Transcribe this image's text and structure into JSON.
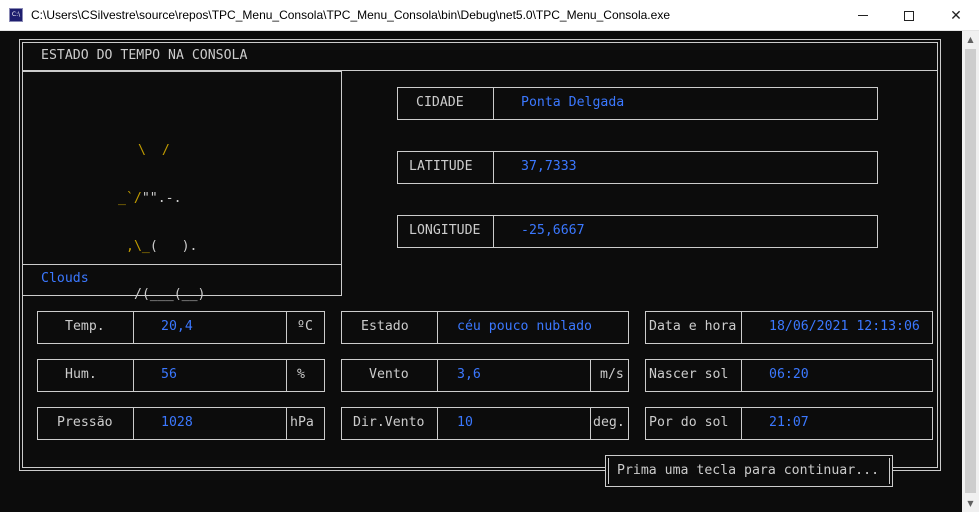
{
  "window": {
    "title": "C:\\Users\\CSilvestre\\source\\repos\\TPC_Menu_Consola\\TPC_Menu_Consola\\bin\\Debug\\net5.0\\TPC_Menu_Consola.exe",
    "icon_label": "C:\\"
  },
  "header": {
    "title": "ESTADO DO TEMPO NA CONSOLA"
  },
  "weather_art": {
    "line1": "\\  /",
    "line2a": "_`/",
    "line2b": "\"\"",
    "line2c": ".-.",
    "line3a": ",\\_",
    "line3b": "(   ).",
    "line4": "/(___(__)",
    "description": "Clouds"
  },
  "location": {
    "city_label": "CIDADE",
    "city_value": "Ponta Delgada",
    "lat_label": "LATITUDE",
    "lat_value": "37,7333",
    "lon_label": "LONGITUDE",
    "lon_value": "-25,6667"
  },
  "metrics": {
    "temp_label": "Temp.",
    "temp_value": "20,4",
    "temp_unit": "ºC",
    "hum_label": "Hum.",
    "hum_value": "56",
    "hum_unit": "%",
    "press_label": "Pressão",
    "press_value": "1028",
    "press_unit": "hPa",
    "state_label": "Estado",
    "state_value": "céu pouco nublado",
    "wind_label": "Vento",
    "wind_value": "3,6",
    "wind_unit": "m/s",
    "winddir_label": "Dir.Vento",
    "winddir_value": "10",
    "winddir_unit": "deg.",
    "datetime_label": "Data e hora",
    "datetime_value": "18/06/2021 12:13:06",
    "sunrise_label": "Nascer sol",
    "sunrise_value": "06:20",
    "sunset_label": "Por do sol",
    "sunset_value": "21:07"
  },
  "footer": {
    "prompt": "Prima uma tecla para continuar..."
  },
  "colors": {
    "console_bg": "#0c0c0c",
    "text": "#cccccc",
    "value": "#3b78ff",
    "art": "#c19c00"
  }
}
